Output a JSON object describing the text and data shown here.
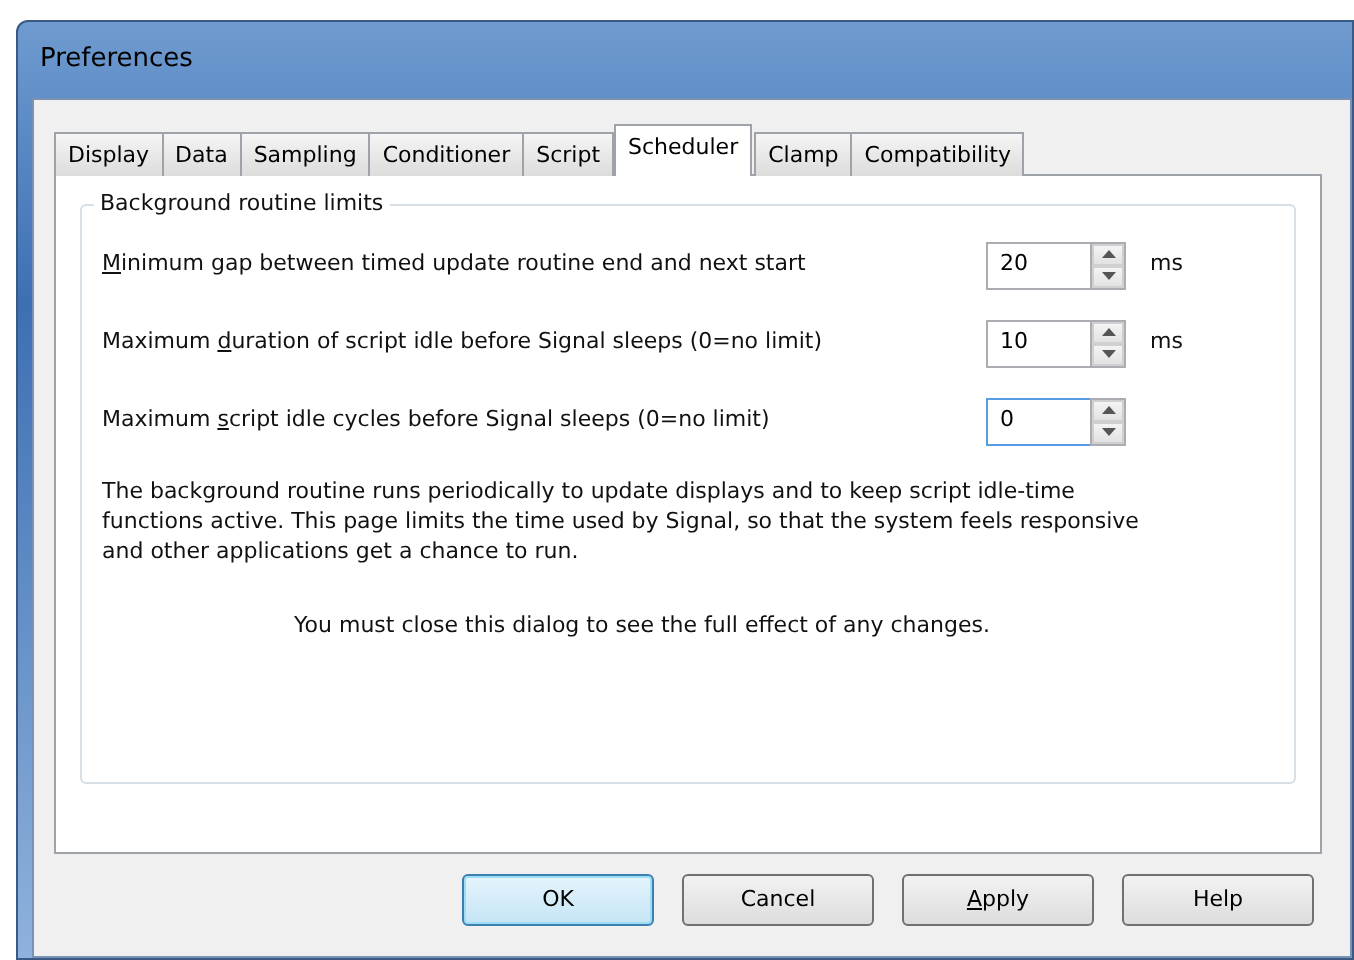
{
  "window": {
    "title": "Preferences"
  },
  "tabs": [
    {
      "label": "Display",
      "selected": false
    },
    {
      "label": "Data",
      "selected": false
    },
    {
      "label": "Sampling",
      "selected": false
    },
    {
      "label": "Conditioner",
      "selected": false
    },
    {
      "label": "Script",
      "selected": false
    },
    {
      "label": "Scheduler",
      "selected": true
    },
    {
      "label": "Clamp",
      "selected": false
    },
    {
      "label": "Compatibility",
      "selected": false
    }
  ],
  "group": {
    "title": "Background routine limits",
    "settings": [
      {
        "label": {
          "key": "M",
          "post": "inimum gap between timed update routine end and next start"
        },
        "value": "20",
        "unit": "ms",
        "focused": false
      },
      {
        "label": {
          "pre": "Maximum ",
          "key": "d",
          "post": "uration of script idle before Signal sleeps (0=no limit)"
        },
        "value": "10",
        "unit": "ms",
        "focused": false
      },
      {
        "label": {
          "pre": "Maximum ",
          "key": "s",
          "post": "cript idle cycles before Signal sleeps (0=no limit)"
        },
        "value": "0",
        "focused": true
      }
    ],
    "description": "The background routine runs periodically to update displays and to keep script idle-time functions active. This page limits the time used by Signal, so that the system feels responsive and other applications get a chance to run.",
    "note": "You must close this dialog to see the full effect of any changes."
  },
  "buttons": [
    {
      "label": {
        "pre": "OK"
      },
      "default": true
    },
    {
      "label": {
        "pre": "Cancel"
      },
      "default": false
    },
    {
      "label": {
        "key": "A",
        "post": "pply"
      },
      "default": false
    },
    {
      "label": {
        "pre": "Help"
      },
      "default": false
    }
  ]
}
